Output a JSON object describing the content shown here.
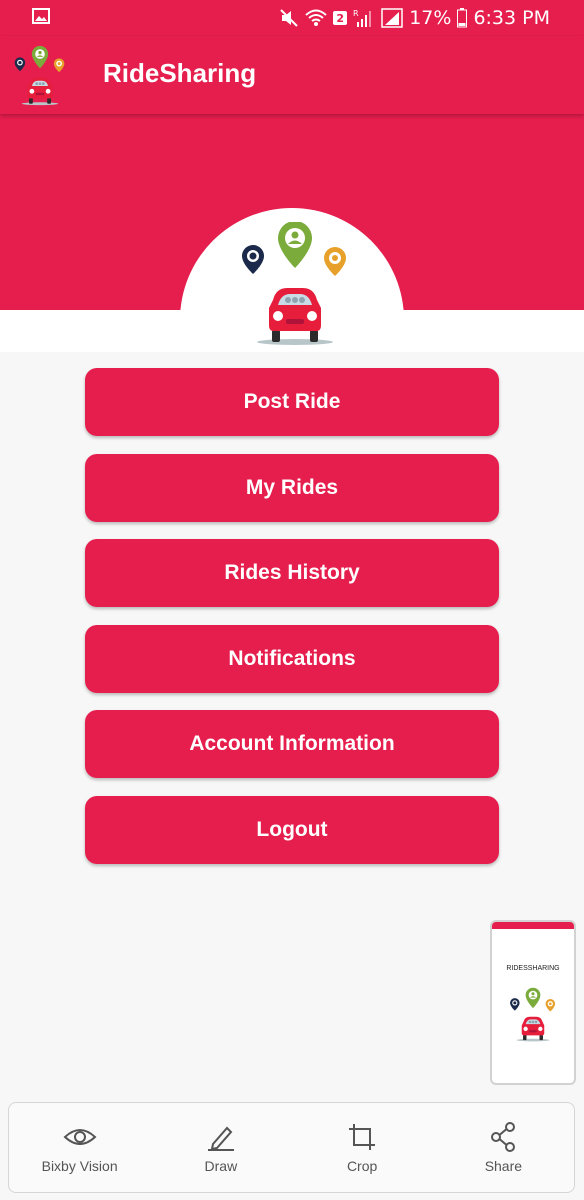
{
  "status_bar": {
    "battery": "17%",
    "time": "6:33 PM",
    "sim_badge": "2",
    "roaming_label": "R"
  },
  "app_bar": {
    "title": "RideSharing"
  },
  "menu": {
    "items": [
      {
        "label": "Post Ride"
      },
      {
        "label": "My Rides"
      },
      {
        "label": "Rides History"
      },
      {
        "label": "Notifications"
      },
      {
        "label": "Account Information"
      },
      {
        "label": "Logout"
      }
    ]
  },
  "screenshot_thumbnail": {
    "title": "RIDESSHARING"
  },
  "toolbar": {
    "items": [
      {
        "label": "Bixby Vision",
        "icon": "eye-icon"
      },
      {
        "label": "Draw",
        "icon": "pencil-icon"
      },
      {
        "label": "Crop",
        "icon": "crop-icon"
      },
      {
        "label": "Share",
        "icon": "share-icon"
      }
    ]
  },
  "colors": {
    "primary": "#e61e4d",
    "pin_navy": "#1b2a4a",
    "pin_green": "#7aab3b",
    "pin_orange": "#e7a12b",
    "car_red": "#e61e3c"
  }
}
